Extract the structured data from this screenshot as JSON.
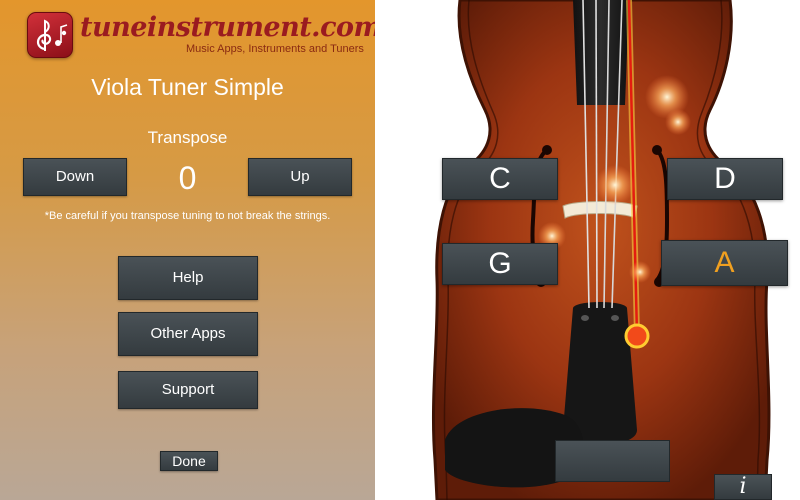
{
  "logo": {
    "brand_text": "tuneinstrument.com",
    "tagline": "Music Apps, Instruments and Tuners"
  },
  "settings": {
    "title": "Viola Tuner Simple",
    "transpose_label": "Transpose",
    "transpose_value": "0",
    "down_label": "Down",
    "up_label": "Up",
    "warning": "*Be careful if you transpose tuning to not break the strings.",
    "help_label": "Help",
    "other_apps_label": "Other Apps",
    "support_label": "Support",
    "done_label": "Done"
  },
  "tuner": {
    "notes": [
      "C",
      "D",
      "G",
      "A"
    ],
    "active_note": "A",
    "active_color": "#f0a020",
    "info_label": "i"
  },
  "colors": {
    "panel_top": "#e3962c",
    "panel_bottom": "#b9a796",
    "button_bg": "#3d4448",
    "brand_red": "#9a1b20"
  }
}
